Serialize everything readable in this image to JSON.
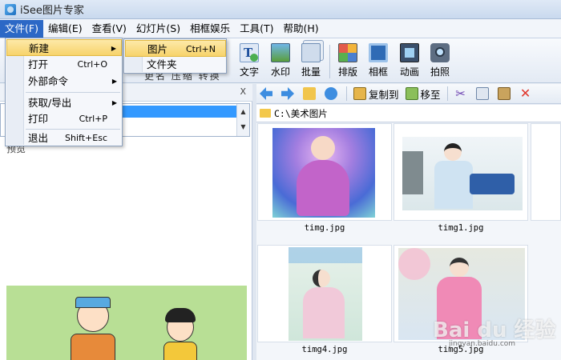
{
  "window": {
    "title": "iSee图片专家"
  },
  "menubar": {
    "items": [
      "文件(F)",
      "编辑(E)",
      "查看(V)",
      "幻灯片(S)",
      "相框娱乐",
      "工具(T)",
      "帮助(H)"
    ]
  },
  "toolbar": {
    "buttons": [
      "文字",
      "水印",
      "批量",
      "排版",
      "相框",
      "动画",
      "拍照"
    ],
    "partial_labels": "更名  压缩  转换"
  },
  "file_menu": {
    "items": [
      {
        "label": "新建",
        "shortcut": "",
        "submenu": true
      },
      {
        "label": "打开",
        "shortcut": "Ctrl+O",
        "submenu": false
      },
      {
        "label": "外部命令",
        "shortcut": "",
        "submenu": true
      },
      {
        "label": "获取/导出",
        "shortcut": "",
        "submenu": true
      },
      {
        "label": "打印",
        "shortcut": "Ctrl+P",
        "submenu": false
      },
      {
        "label": "退出",
        "shortcut": "Shift+Esc",
        "submenu": false
      }
    ]
  },
  "new_submenu": {
    "items": [
      {
        "label": "图片",
        "shortcut": "Ctrl+N"
      },
      {
        "label": "文件夹",
        "shortcut": ""
      }
    ]
  },
  "left_panel": {
    "close_label": "X",
    "preview_label": "预览"
  },
  "right_toolbar": {
    "copy_to": "复制到",
    "move_to": "移至"
  },
  "address": {
    "path": "C:\\美术图片"
  },
  "thumbnails": [
    {
      "filename": "timg.jpg"
    },
    {
      "filename": "timg1.jpg"
    },
    {
      "filename": "timg4.jpg"
    },
    {
      "filename": "timg5.jpg"
    }
  ],
  "watermark": {
    "text": "Bai du 经验",
    "sub": "jingyan.baidu.com"
  },
  "colors": {
    "menu_active": "#2c68c6",
    "menu_highlight": "#f7d36b",
    "selection": "#3399ff"
  }
}
